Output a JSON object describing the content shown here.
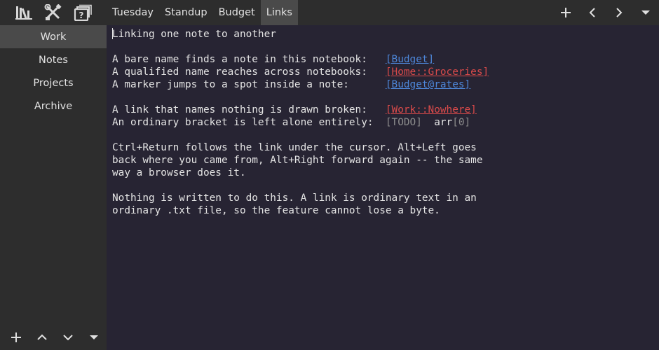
{
  "window": {
    "tabs": [
      "Tuesday",
      "Standup",
      "Budget",
      "Links"
    ],
    "active_tab": "Links"
  },
  "toolbar_icons": [
    "notebooks-icon",
    "settings-tools-icon",
    "help-archive-icon"
  ],
  "nav_icons": [
    "plus-icon",
    "chevron-left-icon",
    "chevron-right-icon",
    "caret-down-icon"
  ],
  "sidebar": {
    "notebooks": [
      "Work",
      "Notes",
      "Projects",
      "Archive"
    ],
    "active": "Work",
    "bottom_icons": [
      "plus-icon",
      "chevron-up-icon",
      "chevron-down-icon",
      "caret-down-icon"
    ]
  },
  "editor": {
    "title_line": "Linking one note to another",
    "bare_label": "A bare name finds a note in this notebook:   ",
    "bare_link": "[Budget]",
    "qualified_label": "A qualified name reaches across notebooks:   ",
    "qualified_link": "[Home::Groceries]",
    "marker_label": "A marker jumps to a spot inside a note:      ",
    "marker_link": "[Budget@rates]",
    "broken_label": "A link that names nothing is drawn broken:   ",
    "broken_link": "[Work::Nowhere]",
    "ordinary_label": "An ordinary bracket is left alone entirely:  ",
    "ordinary_todo": "[TODO]",
    "ordinary_gap": "  arr",
    "ordinary_index": "[0]",
    "para1": [
      "Ctrl+Return follows the link under the cursor. Alt+Left goes",
      "back where you came from, Alt+Right forward again -- the same",
      "way a browser does it."
    ],
    "para2": [
      "Nothing is written to do this. A link is ordinary text in an",
      "ordinary .txt file, so the feature cannot lose a byte."
    ]
  },
  "colors": {
    "link": "#4d86d8",
    "broken_link": "#d94a4a",
    "plain_bracket": "#8c8c8c",
    "editor_bg": "#272433",
    "panel_bg": "#2d2d2d",
    "active_bg": "#4a4a4a"
  }
}
